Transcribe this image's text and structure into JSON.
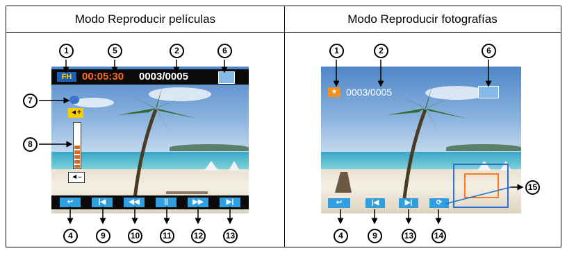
{
  "headers": {
    "left": "Modo Reproducir películas",
    "right": "Modo Reproducir fotografías"
  },
  "movie": {
    "mode_badge": "FH",
    "timecode": "00:05:30",
    "counter": "0003/0005",
    "markers": [
      "1",
      "5",
      "2",
      "6",
      "7",
      "8",
      "4",
      "9",
      "10",
      "11",
      "12",
      "13"
    ]
  },
  "photo": {
    "counter": "0003/0005",
    "markers": [
      "1",
      "2",
      "6",
      "4",
      "9",
      "13",
      "14",
      "15"
    ]
  },
  "colors": {
    "timecode": "#ff6a1a",
    "accent_blue": "#2f9fe0",
    "mode_badge": "#ffcc00",
    "zoom_frame_outer": "#2f6fd0",
    "zoom_frame_inner": "#ff7a1a"
  },
  "icons": {
    "movie_controls": [
      "return-icon",
      "skip-back-icon",
      "rewind-icon",
      "pause-icon",
      "fast-forward-icon",
      "skip-forward-icon"
    ],
    "photo_controls": [
      "return-icon",
      "skip-back-icon",
      "skip-forward-icon",
      "rotate-icon"
    ]
  }
}
